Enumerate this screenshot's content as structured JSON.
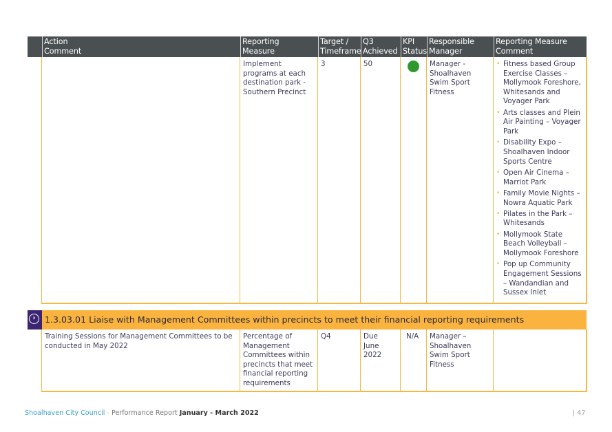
{
  "table": {
    "headers": [
      {
        "line1": "Action",
        "line2": "Comment"
      },
      {
        "line1": "Reporting",
        "line2": "Measure"
      },
      {
        "line1": "Target /",
        "line2": "Timeframe"
      },
      {
        "line1": "Q3",
        "line2": "Achieved"
      },
      {
        "line1": "KPI",
        "line2": "Status"
      },
      {
        "line1": "Responsible",
        "line2": "Manager"
      },
      {
        "line1": "Reporting Measure",
        "line2": "Comment"
      }
    ],
    "row1": {
      "action_comment": "",
      "reporting_measure": "Implement programs at each destination park - Southern Precinct",
      "target": "3",
      "achieved": "50",
      "kpi_status": "green",
      "kpi_color": "#2e9a2e",
      "responsible_manager": "Manager - Shoalhaven Swim Sport Fitness",
      "measure_comment_items": [
        "Fitness based Group Exercise Classes – Mollymook Foreshore, Whitesands and Voyager Park",
        "Arts classes and Plein Air Painting – Voyager Park",
        "Disability Expo – Shoalhaven Indoor Sports Centre",
        "Open Air Cinema – Marriot Park",
        "Family Movie Nights – Nowra Aquatic Park",
        "Pilates in the Park – Whitesands",
        "Mollymook State Beach Volleyball – Mollymook Foreshore",
        "Pop up Community Engagement Sessions – Wandandian and Sussex Inlet"
      ]
    },
    "section": {
      "icon": "chevron-right-circle-icon",
      "title": "1.3.03.01 Liaise with Management Committees within precincts to meet their financial reporting requirements"
    },
    "row2": {
      "action_comment": "Training Sessions for Management Committees to be conducted in May 2022",
      "reporting_measure": "Percentage of Management Committees within precincts that meet financial reporting requirements",
      "target": "Q4",
      "achieved": "Due June 2022",
      "kpi_status": "N/A",
      "responsible_manager": "Manager – Shoalhaven Swim Sport Fitness",
      "measure_comment": ""
    }
  },
  "footer": {
    "council": "Shoalhaven City Council",
    "separator": " - ",
    "report": "Performance Report ",
    "period": "January - March 2022",
    "page": "| 47"
  },
  "colors": {
    "header_bg": "#4a4f51",
    "border": "#f4b942",
    "section_bar": "#fbb33f",
    "section_icon_bg": "#3b2570",
    "footer_council": "#3aa0c8"
  }
}
